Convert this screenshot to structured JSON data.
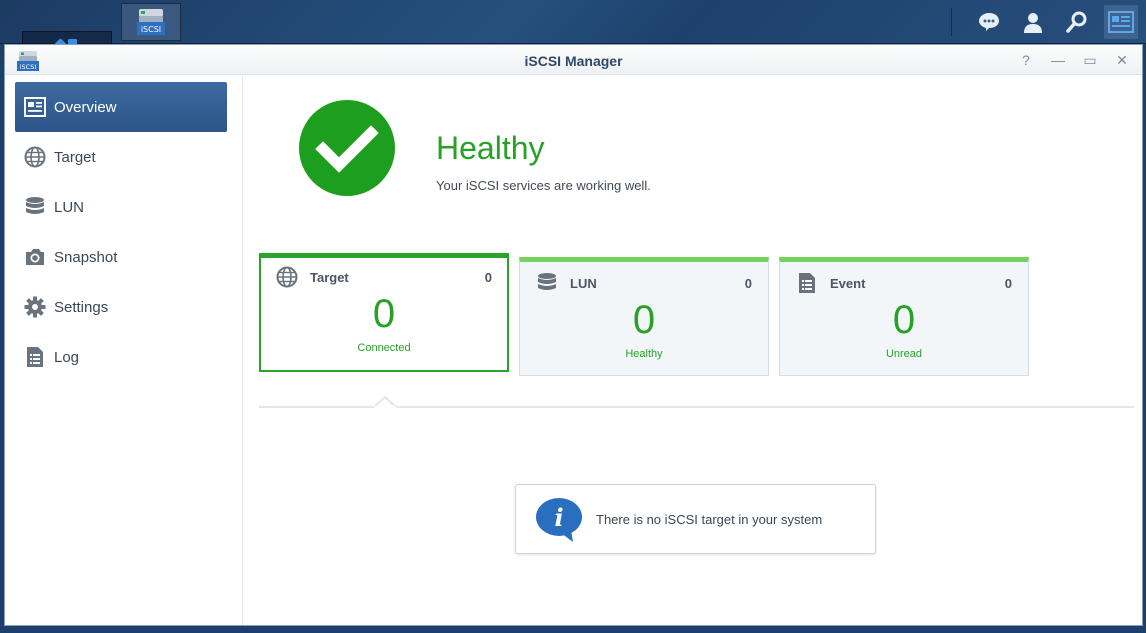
{
  "taskbar": {
    "main_menu_icon": "grid-icon",
    "app_button_label": "iSCSI",
    "right_icons": [
      "chat-icon",
      "user-icon",
      "search-icon",
      "widgets-icon"
    ]
  },
  "window": {
    "title": "iSCSI Manager",
    "app_icon_label": "iSCSI",
    "controls": [
      "?",
      "—",
      "▭",
      "✕"
    ]
  },
  "sidebar": {
    "items": [
      {
        "label": "Overview",
        "icon": "overview-icon",
        "active": true
      },
      {
        "label": "Target",
        "icon": "globe-icon",
        "active": false
      },
      {
        "label": "LUN",
        "icon": "database-icon",
        "active": false
      },
      {
        "label": "Snapshot",
        "icon": "camera-icon",
        "active": false
      },
      {
        "label": "Settings",
        "icon": "gear-icon",
        "active": false
      },
      {
        "label": "Log",
        "icon": "log-icon",
        "active": false
      }
    ]
  },
  "status": {
    "title": "Healthy",
    "description": "Your iSCSI services are working well.",
    "icon": "checkmark-icon"
  },
  "cards": [
    {
      "label": "Target",
      "count": "0",
      "value": "0",
      "sub": "Connected",
      "icon": "globe-icon",
      "selected": true
    },
    {
      "label": "LUN",
      "count": "0",
      "value": "0",
      "sub": "Healthy",
      "icon": "database-icon",
      "selected": false
    },
    {
      "label": "Event",
      "count": "0",
      "value": "0",
      "sub": "Unread",
      "icon": "log-icon",
      "selected": false
    }
  ],
  "info": {
    "message": "There is no iSCSI target in your system",
    "icon": "info-icon"
  },
  "colors": {
    "accent_green": "#27a227",
    "sidebar_active": "#2d5689",
    "card_bar": "#73d35c"
  }
}
